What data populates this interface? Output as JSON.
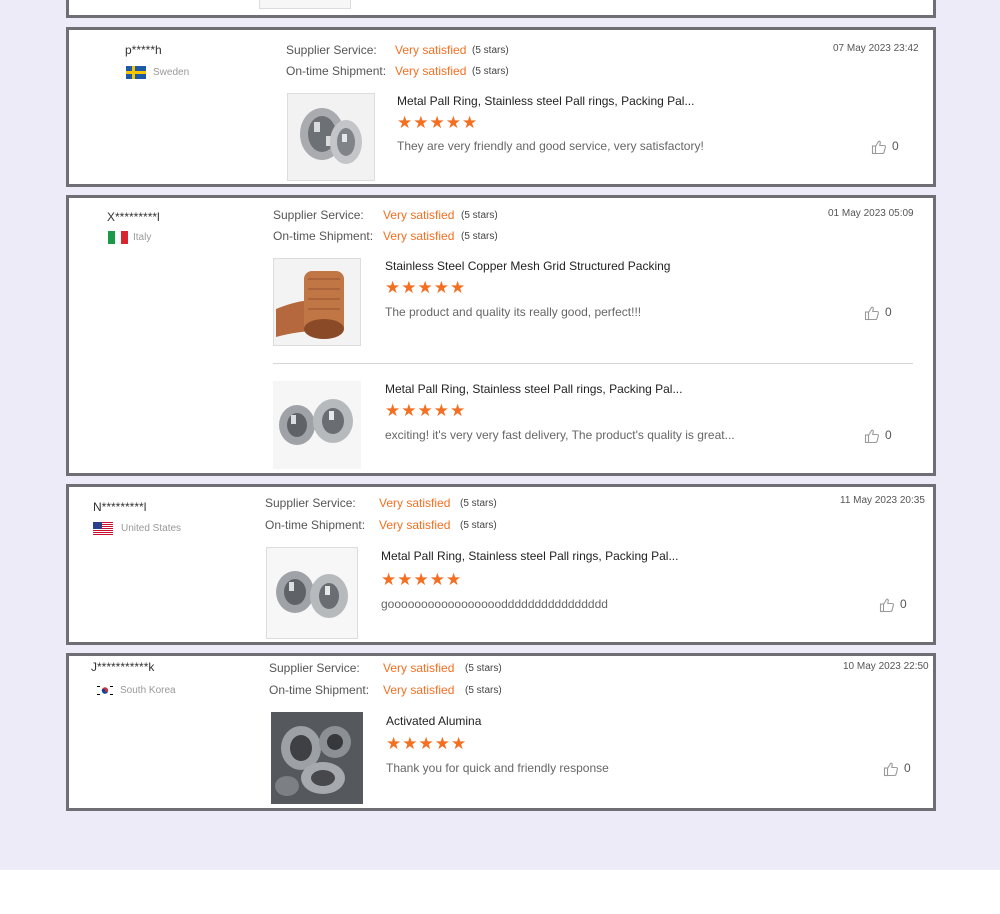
{
  "labels": {
    "supplier_service": "Supplier Service:",
    "ontime_shipment": "On-time Shipment:"
  },
  "colors": {
    "accent": "#f36f21",
    "border": "#6e6e74",
    "background": "#ecebf7"
  },
  "reviews": [
    {
      "user": "p*****h",
      "country": "Sweden",
      "flag": "sweden-flag",
      "date": "07 May 2023 23:42",
      "supplier_rating": "Very satisfied",
      "supplier_stars": "(5 stars)",
      "shipment_rating": "Very satisfied",
      "shipment_stars": "(5 stars)",
      "items": [
        {
          "title": "Metal Pall Ring, Stainless steel Pall rings, Packing Pal...",
          "stars": "★★★★★",
          "rating": 5,
          "text": "They are very friendly and good service, very satisfactory!",
          "likes": "0"
        }
      ]
    },
    {
      "user": "X*********l",
      "country": "Italy",
      "flag": "italy-flag",
      "date": "01 May 2023 05:09",
      "supplier_rating": "Very satisfied",
      "supplier_stars": "(5 stars)",
      "shipment_rating": "Very satisfied",
      "shipment_stars": "(5 stars)",
      "items": [
        {
          "title": "Stainless Steel Copper Mesh Grid Structured Packing",
          "stars": "★★★★★",
          "rating": 5,
          "text": "The product and quality its really good, perfect!!!",
          "likes": "0"
        },
        {
          "title": "Metal Pall Ring, Stainless steel Pall rings, Packing Pal...",
          "stars": "★★★★★",
          "rating": 5,
          "text": "exciting! it's very very fast delivery, The product's quality is great...",
          "likes": "0"
        }
      ]
    },
    {
      "user": "N*********l",
      "country": "United States",
      "flag": "usa-flag",
      "date": "11 May 2023 20:35",
      "supplier_rating": "Very satisfied",
      "supplier_stars": "(5 stars)",
      "shipment_rating": "Very satisfied",
      "shipment_stars": "(5 stars)",
      "items": [
        {
          "title": "Metal Pall Ring, Stainless steel Pall rings, Packing Pal...",
          "stars": "★★★★★",
          "rating": 5,
          "text": "gooooooooooooooooodddddddddddddddd",
          "likes": "0"
        }
      ]
    },
    {
      "user": "J***********k",
      "country": "South Korea",
      "flag": "south-korea-flag",
      "date": "10 May 2023 22:50",
      "supplier_rating": "Very satisfied",
      "supplier_stars": "(5 stars)",
      "shipment_rating": "Very satisfied",
      "shipment_stars": "(5 stars)",
      "items": [
        {
          "title": "Activated Alumina",
          "stars": "★★★★★",
          "rating": 5,
          "text": "Thank you for quick and friendly response",
          "likes": "0"
        }
      ]
    }
  ]
}
